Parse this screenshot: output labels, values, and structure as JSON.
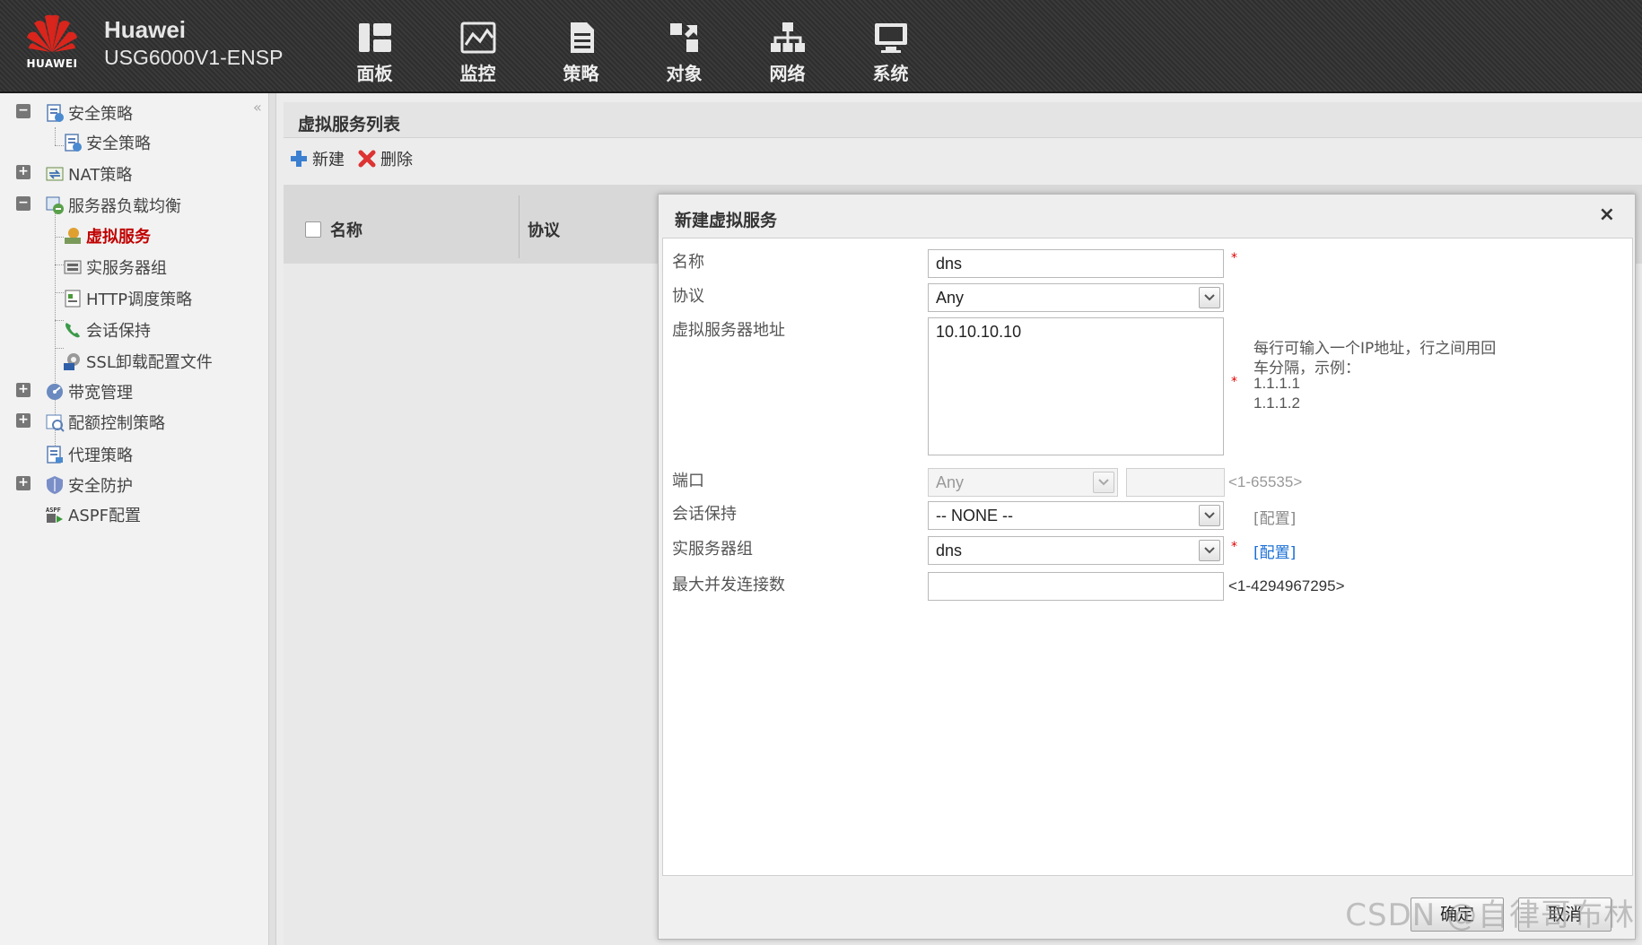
{
  "header": {
    "logo_text": "HUAWEI",
    "brand_name": "Huawei",
    "device_model": "USG6000V1-ENSP",
    "nav": [
      {
        "label": "面板",
        "icon": "dashboard-icon"
      },
      {
        "label": "监控",
        "icon": "monitor-icon"
      },
      {
        "label": "策略",
        "icon": "policy-icon"
      },
      {
        "label": "对象",
        "icon": "object-icon"
      },
      {
        "label": "网络",
        "icon": "network-icon"
      },
      {
        "label": "系统",
        "icon": "system-icon"
      }
    ]
  },
  "sidebar": {
    "collapse": "«",
    "items": [
      {
        "label": "安全策略",
        "toggle": "−"
      },
      {
        "label": "安全策略"
      },
      {
        "label": "NAT策略",
        "toggle": "+"
      },
      {
        "label": "服务器负载均衡",
        "toggle": "−"
      },
      {
        "label": "虚拟服务",
        "active": true
      },
      {
        "label": "实服务器组"
      },
      {
        "label": "HTTP调度策略"
      },
      {
        "label": "会话保持"
      },
      {
        "label": "SSL卸载配置文件"
      },
      {
        "label": "带宽管理",
        "toggle": "+"
      },
      {
        "label": "配额控制策略",
        "toggle": "+"
      },
      {
        "label": "代理策略"
      },
      {
        "label": "安全防护",
        "toggle": "+"
      },
      {
        "label": "ASPF配置"
      }
    ]
  },
  "main": {
    "list_title": "虚拟服务列表",
    "toolbar": {
      "new_label": "新建",
      "delete_label": "删除"
    },
    "columns": [
      "名称",
      "协议"
    ]
  },
  "dialog": {
    "title": "新建虚拟服务",
    "close": "×",
    "required_mark": "*",
    "fields": {
      "name": {
        "label": "名称",
        "value": "dns"
      },
      "protocol": {
        "label": "协议",
        "value": "Any"
      },
      "vip": {
        "label": "虚拟服务器地址",
        "value": "10.10.10.10",
        "hint_line1": "每行可输入一个IP地址，行之间用回",
        "hint_line2": "车分隔，示例：",
        "hint_line3": "1.1.1.1",
        "hint_line4": "1.1.1.2"
      },
      "port": {
        "label": "端口",
        "value": "Any",
        "range": "<1-65535>"
      },
      "persistence": {
        "label": "会话保持",
        "value": "-- NONE --",
        "link": "[配置]"
      },
      "server_group": {
        "label": "实服务器组",
        "value": "dns",
        "link": "[配置]"
      },
      "max_conn": {
        "label": "最大并发连接数",
        "value": "",
        "range": "<1-4294967295>"
      }
    },
    "ok_label": "确定",
    "cancel_label": "取消"
  },
  "watermark": "CSDN @自律哥布林",
  "colors": {
    "active_item": "#c00000",
    "link": "#1a6fd6",
    "required": "#e00000"
  }
}
